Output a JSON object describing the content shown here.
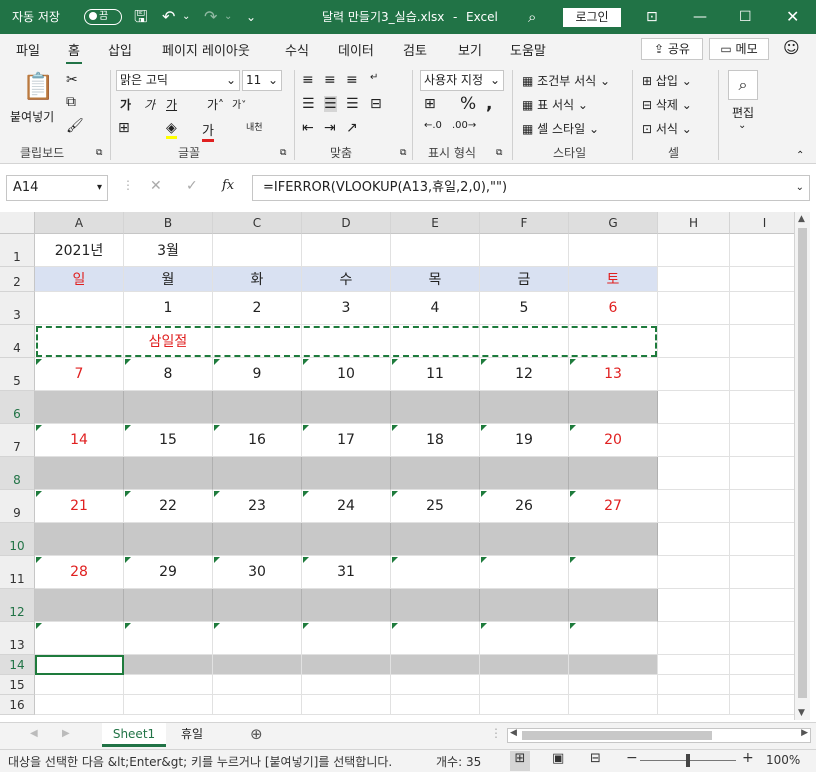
{
  "titlebar": {
    "autosave_label": "자동 저장",
    "autosave_state": "끔",
    "filename": "달력 만들기3_실습.xlsx",
    "separator": "-",
    "app": "Excel",
    "login": "로그인"
  },
  "tabs": [
    "파일",
    "홈",
    "삽입",
    "페이지 레이아웃",
    "수식",
    "데이터",
    "검토",
    "보기",
    "도움말"
  ],
  "share_label": "공유",
  "memo_label": "메모",
  "ribbon": {
    "paste": "붙여넣기",
    "font_name": "맑은 고딕",
    "font_size": "11",
    "number_format": "사용자 지정",
    "conditional": "조건부 서식",
    "table_format": "표 서식",
    "cell_style": "셀 스타일",
    "insert": "삽입",
    "delete": "삭제",
    "format": "서식",
    "edit": "편집",
    "groups": [
      "클립보드",
      "글꼴",
      "맞춤",
      "표시 형식",
      "스타일",
      "셀"
    ]
  },
  "formula_bar": {
    "name_box": "A14",
    "fx": "fx",
    "formula": "=IFERROR(VLOOKUP(A13,휴일,2,0),\"\")"
  },
  "columns": [
    "A",
    "B",
    "C",
    "D",
    "E",
    "F",
    "G",
    "H",
    "I"
  ],
  "rows": [
    "1",
    "2",
    "3",
    "4",
    "5",
    "6",
    "7",
    "8",
    "9",
    "10",
    "11",
    "12",
    "13",
    "14",
    "15",
    "16"
  ],
  "cells": {
    "A1": "2021년",
    "B1": "3월",
    "A2": "일",
    "B2": "월",
    "C2": "화",
    "D2": "수",
    "E2": "목",
    "F2": "금",
    "G2": "토",
    "B3": "1",
    "C3": "2",
    "D3": "3",
    "E3": "4",
    "F3": "5",
    "G3": "6",
    "B4": "삼일절",
    "A5": "7",
    "B5": "8",
    "C5": "9",
    "D5": "10",
    "E5": "11",
    "F5": "12",
    "G5": "13",
    "A7": "14",
    "B7": "15",
    "C7": "16",
    "D7": "17",
    "E7": "18",
    "F7": "19",
    "G7": "20",
    "A9": "21",
    "B9": "22",
    "C9": "23",
    "D9": "24",
    "E9": "25",
    "F9": "26",
    "G9": "27",
    "A11": "28",
    "B11": "29",
    "C11": "30",
    "D11": "31"
  },
  "sheets": [
    "Sheet1",
    "휴일"
  ],
  "status": {
    "message": "대상을 선택한 다음 &lt;Enter&gt; 키를 누르거나 [붙여넣기]를 선택합니다.",
    "count": "개수: 35",
    "zoom": "100%"
  },
  "colors": {
    "accent": "#217346",
    "red": "#e02020",
    "header_fill": "#d9e1f2",
    "gray_fill": "#c8c8c8"
  }
}
